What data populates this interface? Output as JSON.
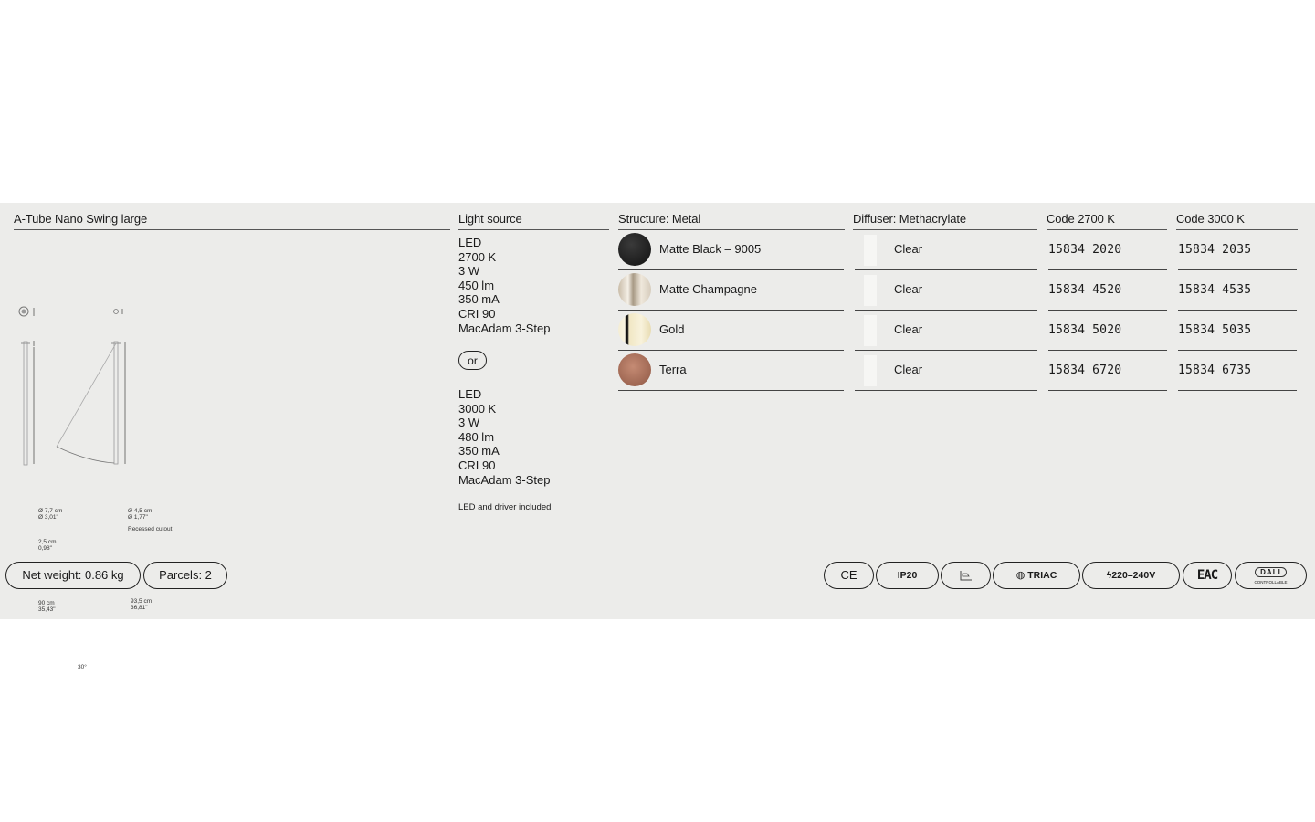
{
  "product": {
    "title": "A-Tube Nano Swing large"
  },
  "headers": {
    "light_source": "Light source",
    "structure": "Structure: Metal",
    "diffuser": "Diffuser: Methacrylate",
    "code_2700": "Code 2700 K",
    "code_3000": "Code 3000 K"
  },
  "light_source_a": [
    "LED",
    "2700 K",
    "3 W",
    "450 lm",
    "350 mA",
    "CRI 90",
    "MacAdam 3-Step"
  ],
  "or_label": "or",
  "light_source_b": [
    "LED",
    "3000 K",
    "3 W",
    "480 lm",
    "350 mA",
    "CRI 90",
    "MacAdam 3-Step"
  ],
  "note": "LED and driver included",
  "variants": [
    {
      "finish": "Matte Black – 9005",
      "diffuser": "Clear",
      "code_2700": "15834  2020",
      "code_3000": "15834  2035",
      "swatch": "#1e1e1e"
    },
    {
      "finish": "Matte Champagne",
      "diffuser": "Clear",
      "code_2700": "15834  4520",
      "code_3000": "15834  4535",
      "swatch": "#d9cfc0"
    },
    {
      "finish": "Gold",
      "diffuser": "Clear",
      "code_2700": "15834  5020",
      "code_3000": "15834  5035",
      "swatch": "#efe6c6"
    },
    {
      "finish": "Terra",
      "diffuser": "Clear",
      "code_2700": "15834  6720",
      "code_3000": "15834  6735",
      "swatch": "#a8705a"
    }
  ],
  "drawing": {
    "top_a": [
      "Ø 7,7 cm",
      "Ø 3,01\""
    ],
    "top_b": [
      "Ø 4,5 cm",
      "Ø 1,77\"",
      "Recessed cutout"
    ],
    "d1": [
      "2,5 cm",
      "0,98\""
    ],
    "d2": [
      "90 cm",
      "35,43\""
    ],
    "d3": [
      "93,5 cm",
      "36,81\""
    ],
    "angle": "30°"
  },
  "footer": {
    "net_weight": "Net weight: 0.86 kg",
    "parcels": "Parcels: 2",
    "badges": {
      "ce": "CE",
      "ip": "IP20",
      "triac": "TRIAC",
      "voltage": "220–240V",
      "eac": "EAC",
      "dali": "DALI",
      "dali_sub": "CONTROLLABLE"
    }
  }
}
